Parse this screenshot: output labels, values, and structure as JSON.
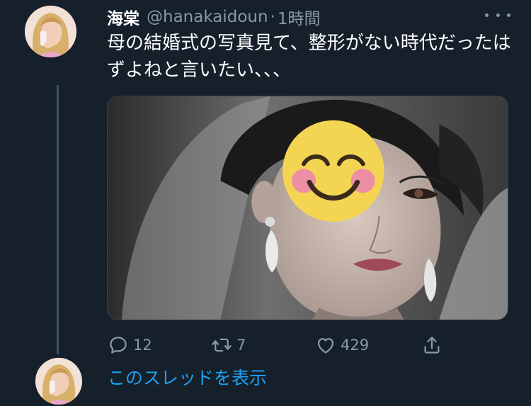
{
  "tweet": {
    "display_name": "海棠",
    "handle": "@hanakaidoun",
    "separator": "·",
    "time": "1時間",
    "text": "母の結婚式の写真見て、整形がない時代だったはずよねと言いたい、、、",
    "image_icon": "smiling-emoji-sticker"
  },
  "actions": {
    "reply_count": "12",
    "retweet_count": "7",
    "like_count": "429",
    "reply_icon": "comment-icon",
    "retweet_icon": "retweet-icon",
    "like_icon": "heart-icon",
    "share_icon": "share-icon"
  },
  "thread": {
    "show_thread_label": "このスレッドを表示"
  },
  "colors": {
    "background": "#15202b",
    "text_primary": "#ffffff",
    "text_secondary": "#8899a6",
    "accent": "#1da1f2",
    "divider": "#38444d"
  }
}
